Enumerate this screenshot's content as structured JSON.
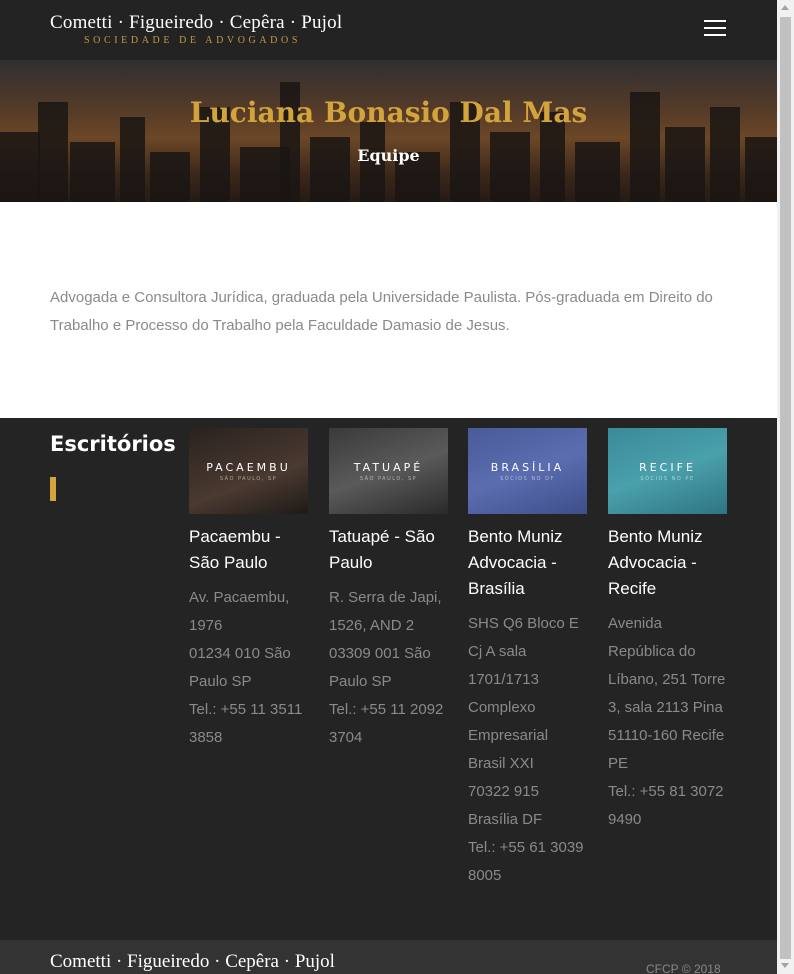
{
  "header": {
    "logo_main": "Cometti · Figueiredo · Cepêra · Pujol",
    "logo_sub": "SOCIEDADE DE ADVOGADOS",
    "menu_icon": "hamburger-menu-icon"
  },
  "hero": {
    "title": "Luciana Bonasio Dal Mas",
    "subtitle": "Equipe"
  },
  "bio": {
    "text": "Advogada e Consultora Jurídica, graduada pela Universidade Paulista. Pós-graduada em Direito do Trabalho e Processo do Trabalho pela Faculdade Damasio de Jesus."
  },
  "offices": {
    "title": "Escritórios",
    "items": [
      {
        "thumb_name": "PACAEMBU",
        "thumb_sub": "SÃO PAULO, SP",
        "name": "Pacaembu - São Paulo",
        "address": "Av. Pacaembu, 1976\n01234 010 São Paulo SP\nTel.: +55 11 3511 3858"
      },
      {
        "thumb_name": "TATUAPÉ",
        "thumb_sub": "SÃO PAULO, SP",
        "name": "Tatuapé - São Paulo",
        "address": "R. Serra de Japi, 1526, AND 2\n03309 001 São Paulo SP\nTel.: +55 11 2092 3704"
      },
      {
        "thumb_name": "BRASÍLIA",
        "thumb_sub": "SÓCIOS NO DF",
        "name": "Bento Muniz Advocacia - Brasília",
        "address": "SHS Q6 Bloco E Cj A sala 1701/1713 Complexo Empresarial Brasil XXI\n70322 915 Brasília DF\nTel.: +55 61 3039 8005"
      },
      {
        "thumb_name": "RECIFE",
        "thumb_sub": "SÓCIOS NO PE",
        "name": "Bento Muniz Advocacia - Recife",
        "address": "Avenida República do Líbano, 251 Torre 3, sala 2113 Pina\n51110-160 Recife PE\nTel.: +55 81 3072 9490"
      }
    ]
  },
  "footer": {
    "logo": "Cometti · Figueiredo · Cepêra · Pujol",
    "copyright": "CFCP © 2018"
  },
  "colors": {
    "accent": "#d4a43c",
    "dark": "#242424",
    "text_muted": "#8a8a8a"
  }
}
